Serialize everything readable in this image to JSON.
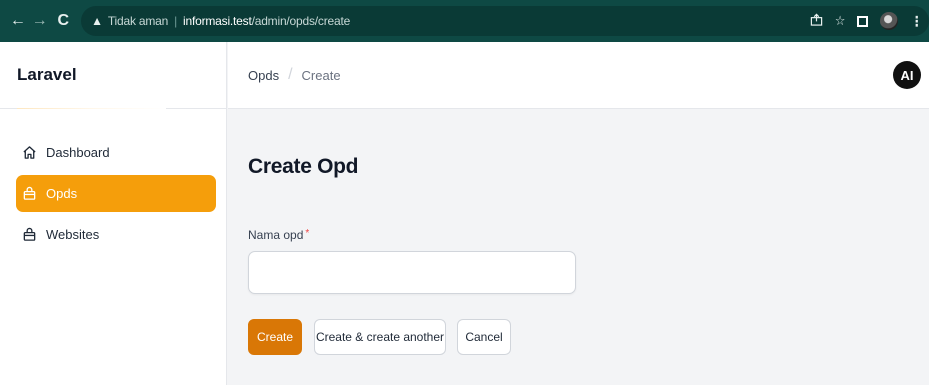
{
  "browser": {
    "security_label": "Tidak aman",
    "url_host": "informasi.test",
    "url_path": "/admin/opds/create"
  },
  "sidebar": {
    "brand": "Laravel",
    "items": [
      {
        "label": "Dashboard",
        "icon": "home-icon",
        "active": false
      },
      {
        "label": "Opds",
        "icon": "shopping-bag-icon",
        "active": true
      },
      {
        "label": "Websites",
        "icon": "shopping-bag-icon",
        "active": false
      }
    ]
  },
  "header": {
    "breadcrumbs": [
      "Opds",
      "Create"
    ],
    "avatar_initials": "AI"
  },
  "main": {
    "title": "Create Opd",
    "field": {
      "label": "Nama opd",
      "required_mark": "*",
      "value": ""
    },
    "buttons": {
      "create": "Create",
      "create_another": "Create & create another",
      "cancel": "Cancel"
    }
  },
  "colors": {
    "accent": "#f59e0b",
    "primary_button": "#d97706",
    "browser_chrome": "#0e4944"
  }
}
